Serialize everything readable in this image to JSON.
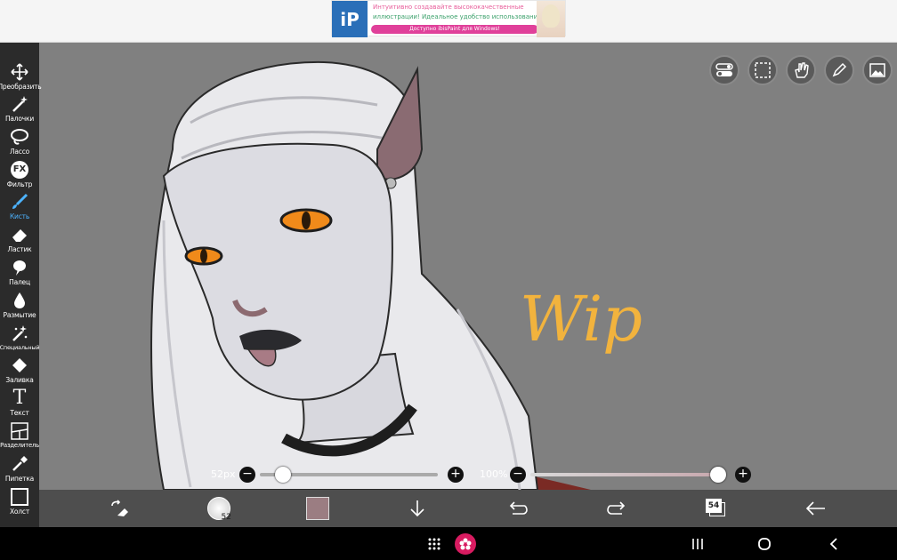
{
  "ad": {
    "logo": "iP",
    "line1": "Интуитивно создавайте высококачественные",
    "line2": "иллюстрации! Идеальное удобство использования!",
    "cta": "Доступно ibisPaint для Windows!"
  },
  "toolbar": {
    "tools": [
      {
        "label": "Преобразить",
        "icon": "move-icon"
      },
      {
        "label": "Палочки",
        "icon": "magic-wand-icon"
      },
      {
        "label": "Лассо",
        "icon": "lasso-icon"
      },
      {
        "label": "Фильтр",
        "icon": "fx-icon",
        "glyph": "FX"
      },
      {
        "label": "Кисть",
        "icon": "brush-icon",
        "active": true
      },
      {
        "label": "Ластик",
        "icon": "eraser-icon"
      },
      {
        "label": "Палец",
        "icon": "smudge-icon"
      },
      {
        "label": "Размытие",
        "icon": "blur-icon"
      },
      {
        "label": "Специальный",
        "icon": "special-icon"
      },
      {
        "label": "Заливка",
        "icon": "fill-icon"
      },
      {
        "label": "Текст",
        "icon": "text-icon",
        "glyph": "T"
      },
      {
        "label": "Разделитель",
        "icon": "frame-divider-icon"
      },
      {
        "label": "Пипетка",
        "icon": "eyedropper-icon"
      },
      {
        "label": "Холст",
        "icon": "canvas-icon"
      }
    ]
  },
  "canvas": {
    "artwork_text": "Wip"
  },
  "sliders": {
    "brush_size": "52px",
    "brush_size_fraction": 0.03,
    "opacity": "100%",
    "opacity_fraction": 1.0
  },
  "bottom": {
    "brush_size_badge": "52",
    "layer_count": "54",
    "color": "#9b7d82"
  },
  "colors": {
    "accent": "#4db3ff",
    "toolbar_bg": "#2b2b2b",
    "canvas_bg": "#808080"
  }
}
